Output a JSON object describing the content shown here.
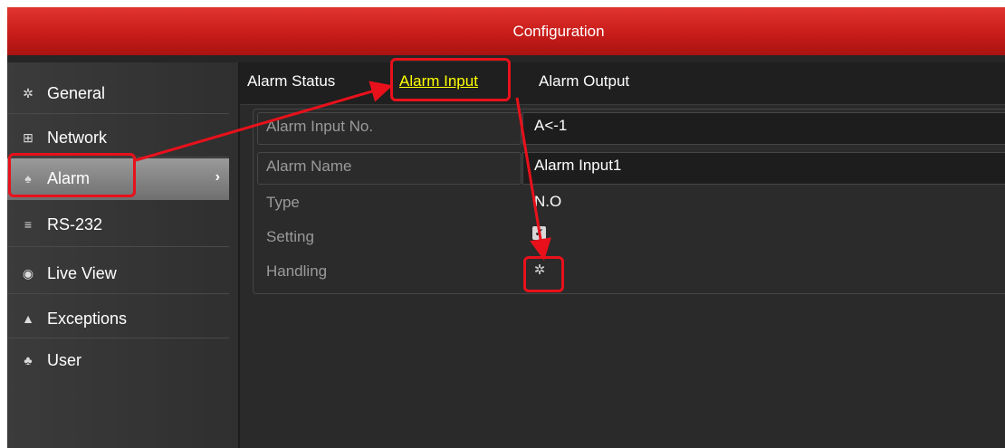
{
  "window": {
    "title": "Configuration"
  },
  "sidebar": {
    "items": [
      {
        "label": "General",
        "icon": "gear-icon"
      },
      {
        "label": "Network",
        "icon": "network-icon"
      },
      {
        "label": "Alarm",
        "icon": "alarm-bell-icon",
        "active": true
      },
      {
        "label": "RS-232",
        "icon": "serial-port-icon"
      },
      {
        "label": "Live View",
        "icon": "eye-icon"
      },
      {
        "label": "Exceptions",
        "icon": "warning-icon"
      },
      {
        "label": "User",
        "icon": "users-icon"
      }
    ],
    "active_arrow": "›"
  },
  "tabs": [
    {
      "label": "Alarm Status"
    },
    {
      "label": "Alarm Input",
      "active": true
    },
    {
      "label": "Alarm Output"
    }
  ],
  "form": {
    "alarm_input_no": {
      "label": "Alarm Input No.",
      "value": "A<-1"
    },
    "alarm_name": {
      "label": "Alarm Name",
      "value": "Alarm Input1"
    },
    "type": {
      "label": "Type",
      "value": "N.O"
    },
    "setting": {
      "label": "Setting",
      "checked": true
    },
    "handling": {
      "label": "Handling",
      "icon": "gear-icon"
    }
  },
  "colors": {
    "title_bar": "#c81d1a",
    "highlight": "#e8111b",
    "active_tab": "#ffff00"
  }
}
